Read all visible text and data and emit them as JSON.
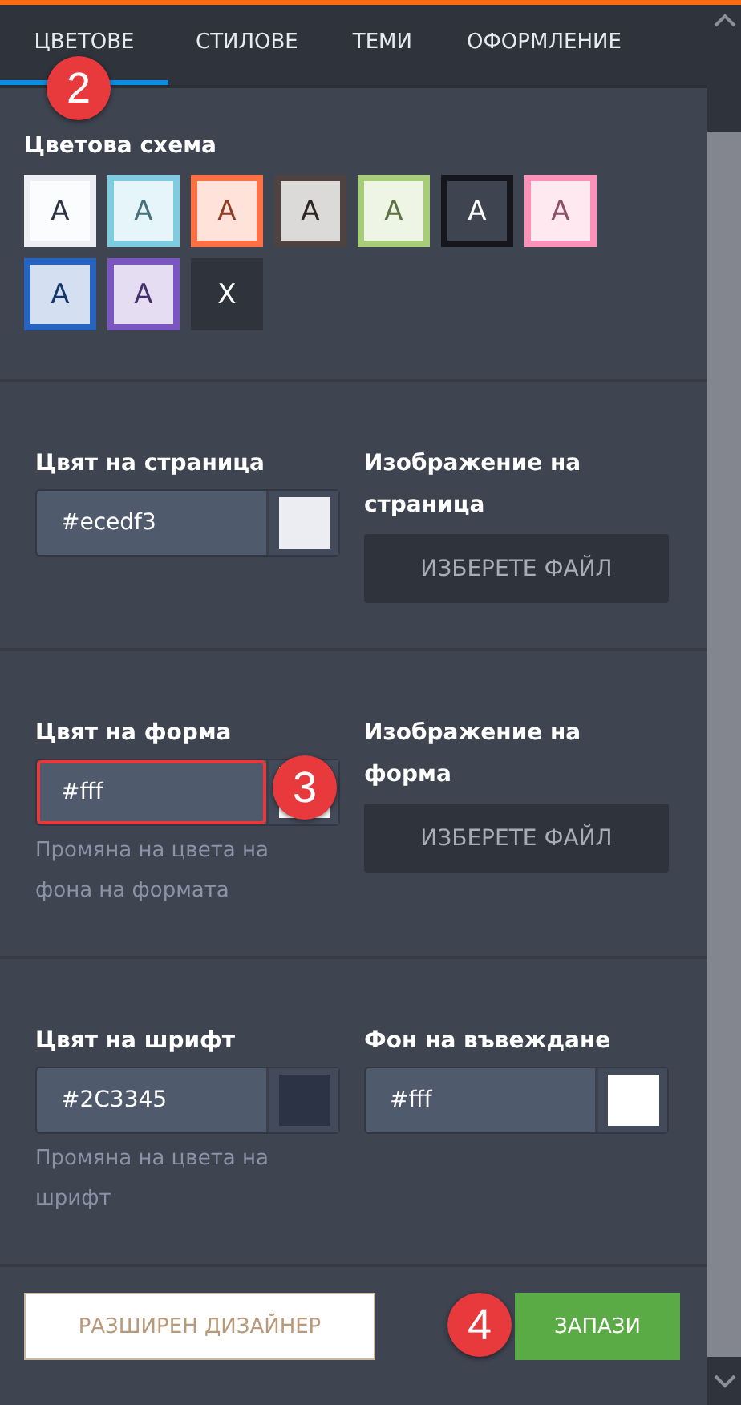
{
  "tabs": [
    {
      "label": "ЦВЕТОВЕ",
      "selected": true,
      "annotation": "2"
    },
    {
      "label": "СТИЛОВЕ",
      "selected": false
    },
    {
      "label": "ТЕМИ",
      "selected": false
    },
    {
      "label": "ОФОРМЛЕНИЕ",
      "selected": false
    }
  ],
  "color_scheme": {
    "title": "Цветова схема",
    "swatches": [
      {
        "kind": "scheme",
        "label": "A",
        "color": "#eceef3"
      },
      {
        "kind": "scheme",
        "label": "A",
        "color": "#7fcbe0"
      },
      {
        "kind": "scheme",
        "label": "A",
        "color": "#ff7043"
      },
      {
        "kind": "scheme",
        "label": "A",
        "color": "#4e4340"
      },
      {
        "kind": "scheme",
        "label": "A",
        "color": "#a8cd7a"
      },
      {
        "kind": "scheme",
        "label": "A",
        "color": "#16171c"
      },
      {
        "kind": "scheme",
        "label": "A",
        "color": "#ff91b8"
      },
      {
        "kind": "scheme",
        "label": "A",
        "color": "#2763c0"
      },
      {
        "kind": "scheme",
        "label": "A",
        "color": "#7b55c0"
      },
      {
        "kind": "reset",
        "label": "X"
      }
    ]
  },
  "sections": [
    {
      "fields": [
        {
          "kind": "color",
          "label": "Цвят на страница",
          "value": "#ecedf3",
          "color": "#ecedf3",
          "highlighted": false
        },
        {
          "kind": "file",
          "label": "Изображение на страница",
          "button": "ИЗБЕРЕТЕ ФАЙЛ"
        }
      ]
    },
    {
      "fields": [
        {
          "kind": "color",
          "label": "Цвят на форма",
          "value": "#fff",
          "color": "#ffffff",
          "highlighted": true,
          "annotation": "3",
          "hint": "Промяна на цвета на фона на формата"
        },
        {
          "kind": "file",
          "label": "Изображение на форма",
          "button": "ИЗБЕРЕТЕ ФАЙЛ"
        }
      ]
    },
    {
      "fields": [
        {
          "kind": "color",
          "label": "Цвят на шрифт",
          "value": "#2C3345",
          "color": "#2c3345",
          "highlighted": false,
          "hint": "Промяна на цвета на шрифт"
        },
        {
          "kind": "color",
          "label": "Фон на въвеждане",
          "value": "#fff",
          "color": "#ffffff",
          "highlighted": false
        }
      ]
    }
  ],
  "footer": {
    "advanced_button": "РАЗШИРЕН ДИЗАЙНЕР",
    "save_button": "ЗАПАЗИ",
    "save_annotation": "4"
  }
}
